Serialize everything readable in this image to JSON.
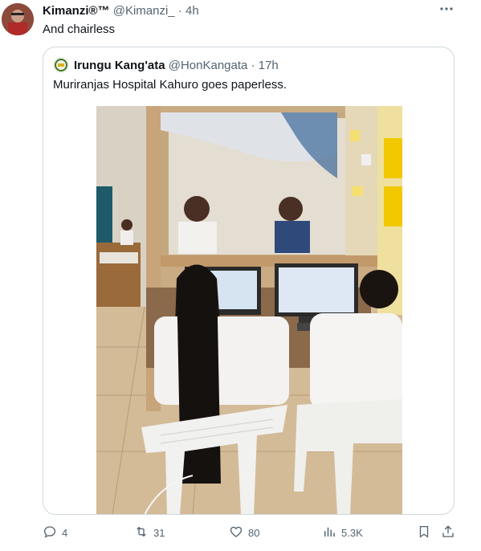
{
  "tweet": {
    "display_name": "Kimanzi®™",
    "handle": "@Kimanzi_",
    "separator": "·",
    "time": "4h",
    "text": "And chairless"
  },
  "quoted": {
    "display_name": "Irungu Kang'ata",
    "handle": "@HonKangata",
    "separator": "·",
    "time": "17h",
    "text": "Muriranjas Hospital Kahuro  goes paperless."
  },
  "actions": {
    "replies": "4",
    "retweets": "31",
    "likes": "80",
    "views": "5.3K"
  },
  "icons": [
    "more-icon",
    "reply-icon",
    "retweet-icon",
    "like-icon",
    "views-icon",
    "bookmark-icon",
    "share-icon"
  ],
  "colors": {
    "text": "#0f1419",
    "muted": "#536471",
    "border": "#cfd9de"
  }
}
